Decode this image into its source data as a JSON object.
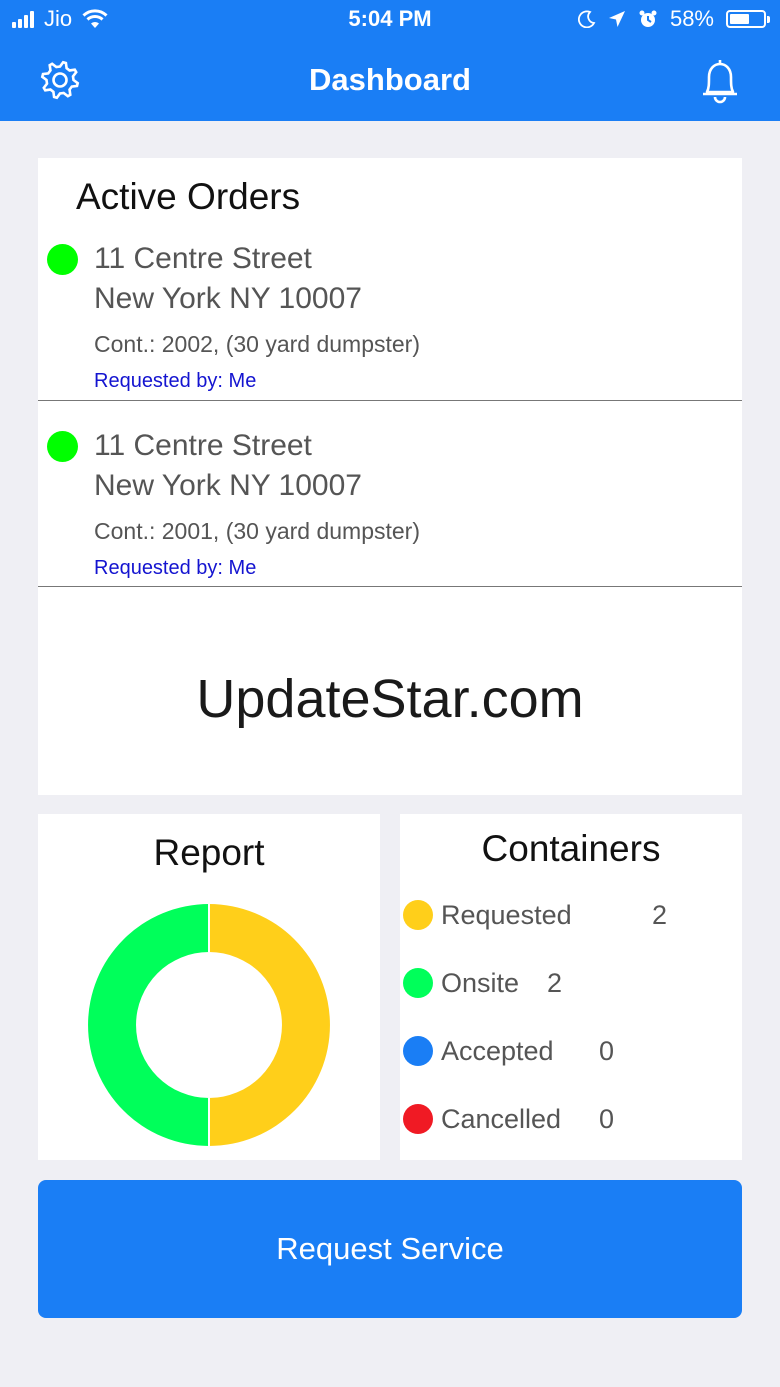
{
  "status_bar": {
    "carrier": "Jio",
    "time": "5:04 PM",
    "battery_text": "58%",
    "battery_level": 0.58
  },
  "nav": {
    "title": "Dashboard",
    "left_icon": "gear-icon",
    "right_icon": "bell-icon"
  },
  "active_orders": {
    "title": "Active Orders",
    "items": [
      {
        "address_line1": "11 Centre Street",
        "address_line2": "New York NY 10007",
        "container": "Cont.: 2002, (30 yard dumpster)",
        "requested_by": "Requested by: Me",
        "status_color": "#00ff00"
      },
      {
        "address_line1": "11 Centre Street",
        "address_line2": "New York NY 10007",
        "container": "Cont.: 2001, (30 yard dumpster)",
        "requested_by": "Requested by: Me",
        "status_color": "#00ff00"
      }
    ]
  },
  "watermark": "UpdateStar.com",
  "report": {
    "title": "Report"
  },
  "containers": {
    "title": "Containers",
    "items": [
      {
        "label": "Requested",
        "count": "2",
        "color": "#ffcf1a"
      },
      {
        "label": "Onsite",
        "count": "2",
        "color": "#00ff5a"
      },
      {
        "label": "Accepted",
        "count": "0",
        "color": "#1a7ef5"
      },
      {
        "label": "Cancelled",
        "count": "0",
        "color": "#f01a24"
      }
    ]
  },
  "request_button": {
    "label": "Request Service"
  },
  "colors": {
    "accent": "#1a7ef5",
    "background": "#efeff4"
  }
}
